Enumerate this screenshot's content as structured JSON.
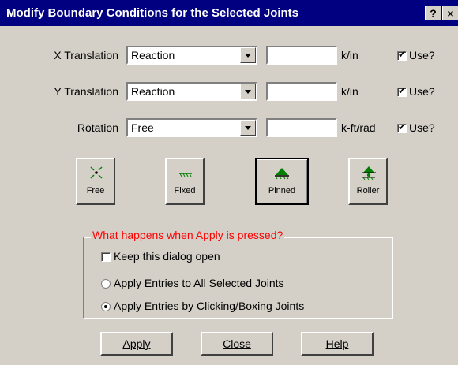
{
  "window": {
    "title": "Modify Boundary Conditions for the Selected Joints",
    "help_label": "?",
    "close_label": "×"
  },
  "rows": [
    {
      "label": "X Translation",
      "type": "Reaction",
      "value": "",
      "unit": "k/in",
      "use_label": "Use?",
      "use_checked": true
    },
    {
      "label": "Y Translation",
      "type": "Reaction",
      "value": "",
      "unit": "k/in",
      "use_label": "Use?",
      "use_checked": true
    },
    {
      "label": "Rotation",
      "type": "Free",
      "value": "",
      "unit": "k-ft/rad",
      "use_label": "Use?",
      "use_checked": true
    }
  ],
  "presets": [
    {
      "label": "Free",
      "icon": "free-support-icon",
      "pressed": false
    },
    {
      "label": "Fixed",
      "icon": "fixed-support-icon",
      "pressed": false
    },
    {
      "label": "Pinned",
      "icon": "pinned-support-icon",
      "pressed": true
    },
    {
      "label": "Roller",
      "icon": "roller-support-icon",
      "pressed": false
    }
  ],
  "apply_group": {
    "title": "What happens when Apply is pressed?",
    "keep_open_label": "Keep this dialog open",
    "keep_open_checked": false,
    "options": [
      {
        "label": "Apply Entries to All Selected Joints",
        "selected": false
      },
      {
        "label": "Apply Entries by Clicking/Boxing Joints",
        "selected": true
      }
    ]
  },
  "buttons": {
    "apply": "Apply",
    "close": "Close",
    "help": "Help"
  },
  "colors": {
    "titlebar": "#000080",
    "face": "#d4d0c8",
    "group_title": "#ff0000",
    "support_green": "#008000"
  }
}
